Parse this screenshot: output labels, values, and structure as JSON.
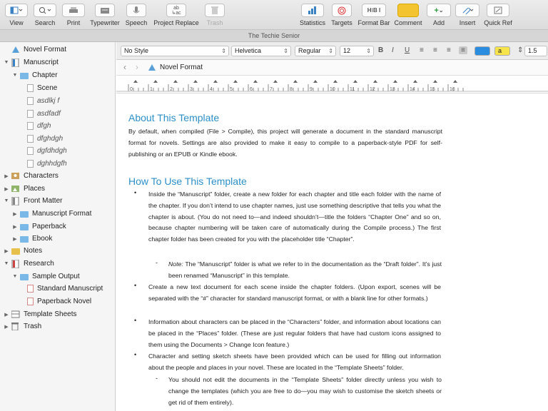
{
  "toolbar": {
    "view": "View",
    "search": "Search",
    "print": "Print",
    "typewriter": "Typewriter",
    "speech": "Speech",
    "project_replace": "Project Replace",
    "trash": "Trash",
    "statistics": "Statistics",
    "targets": "Targets",
    "format_bar": "Format Bar",
    "comment": "Comment",
    "add": "Add",
    "insert": "Insert",
    "quick_ref": "Quick Ref",
    "format_bar_icon_text": "H⁝B I"
  },
  "window_title": "The Techie Senior",
  "binder": {
    "items": [
      {
        "label": "Novel Format"
      },
      {
        "label": "Manuscript"
      },
      {
        "label": "Chapter"
      },
      {
        "label": "Scene"
      },
      {
        "label": "asdlkj f"
      },
      {
        "label": "asdfadf"
      },
      {
        "label": "dfgh"
      },
      {
        "label": "dfghdgh"
      },
      {
        "label": "dgfdhdgh"
      },
      {
        "label": "dghhdgfh"
      },
      {
        "label": "Characters"
      },
      {
        "label": "Places"
      },
      {
        "label": "Front Matter"
      },
      {
        "label": "Manuscript Format"
      },
      {
        "label": "Paperback"
      },
      {
        "label": "Ebook"
      },
      {
        "label": "Notes"
      },
      {
        "label": "Research"
      },
      {
        "label": "Sample Output"
      },
      {
        "label": "Standard Manuscript"
      },
      {
        "label": "Paperback Novel"
      },
      {
        "label": "Template Sheets"
      },
      {
        "label": "Trash"
      }
    ]
  },
  "formatbar": {
    "style": "No Style",
    "font": "Helvetica",
    "weight": "Regular",
    "size": "12",
    "bold": "B",
    "italic": "I",
    "underline": "U",
    "highlight": "a",
    "line_spacing": "1.5"
  },
  "nav": {
    "doc_title": "Novel Format"
  },
  "ruler": {
    "labels": [
      "0",
      "1",
      "2",
      "3",
      "4",
      "5",
      "6",
      "7",
      "8",
      "9",
      "10",
      "11",
      "12",
      "13",
      "14",
      "15",
      "16"
    ]
  },
  "editor": {
    "h1": "About This Template",
    "p1": "By default, when compiled (File > Compile), this project will generate a document in the standard manuscript format for novels. Settings are also provided to make it easy to compile to a paperback-style PDF for self-publishing or an EPUB or Kindle ebook.",
    "h2": "How To Use This Template",
    "b1": "Inside the “Manuscript” folder, create a new folder for each chapter and title each folder with the name of the chapter. If you don’t intend to use chapter names, just use something descriptive that tells you what the chapter is about. (You do not need to—and indeed shouldn’t—title the folders “Chapter One” and so on, because chapter numbering will be taken care of automatically during the Compile process.) The first chapter folder has been created for you with the placeholder title “Chapter”.",
    "s1_note": "Note:",
    "s1": "The “Manuscript” folder is what we refer to in the documentation as the “Draft folder”. It’s just been renamed “Manuscript” in this template.",
    "b2": "Create a new text document for each scene inside the chapter folders. (Upon export, scenes will be separated with the “#” character for standard manuscript format, or with a blank line for other formats.)",
    "b3": "Information about characters can be placed in the “Characters” folder, and information about locations can be placed in the “Places” folder. (These are just regular folders that have had custom icons assigned to them using the Documents > Change Icon feature.)",
    "b4": "Character and setting sketch sheets have been provided which can be used for filling out information about the people and places in your novel. These are located in the “Template Sheets” folder.",
    "s2": "You should not edit the documents in the “Template Sheets” folder directly unless you wish to change the templates (which you are free to do—you may wish to customise the sketch sheets or get rid of them entirely).",
    "bullet": "•",
    "dash": "-"
  },
  "colors": {
    "accent": "#2b8fc9",
    "heading": "#2b8fc9",
    "comment": "#f4c430",
    "text_color_swatch": "#2a8de0",
    "highlight_swatch": "#f7e34a"
  }
}
